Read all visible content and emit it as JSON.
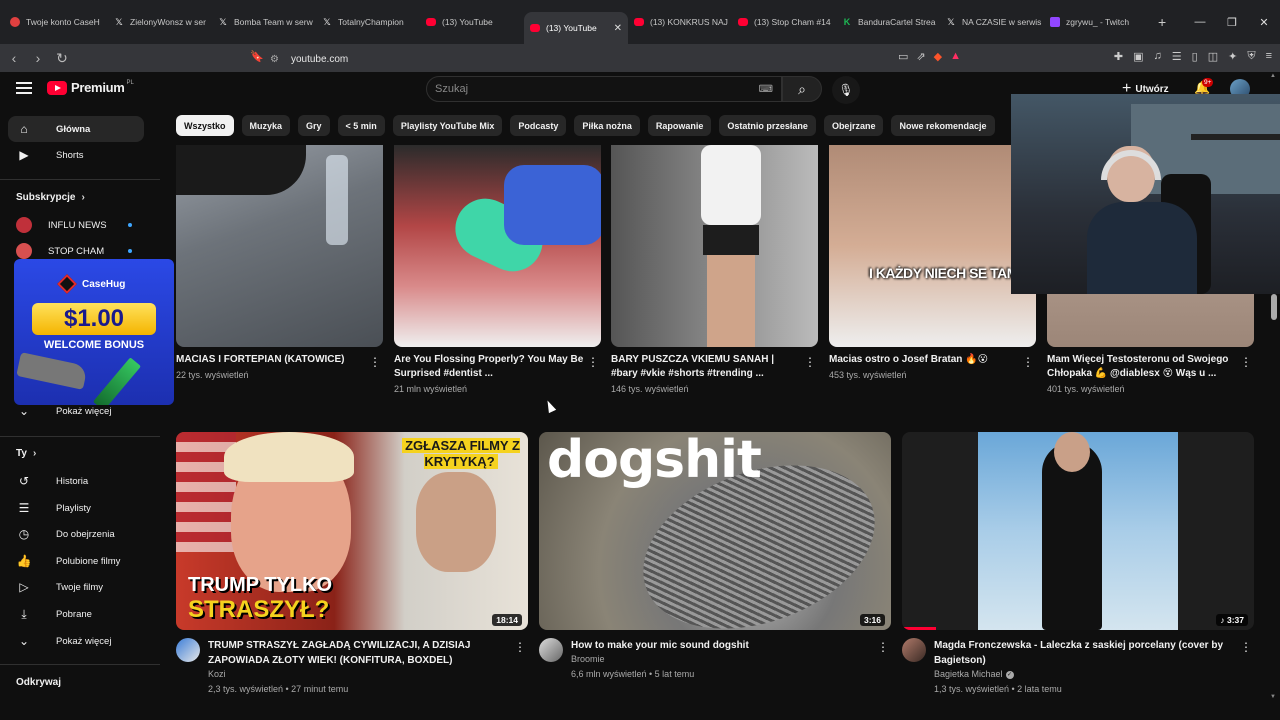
{
  "browser": {
    "tabs": [
      {
        "label": "Twoje konto CaseH",
        "icon": "dot-icon"
      },
      {
        "label": "ZielonyWonsz w ser",
        "icon": "x-icon"
      },
      {
        "label": "Bomba Team w serw",
        "icon": "x-icon"
      },
      {
        "label": "TotalnyChampion",
        "icon": "x-icon"
      },
      {
        "label": "(13) YouTube",
        "icon": "youtube-icon"
      },
      {
        "label": "(13) YouTube",
        "icon": "youtube-icon",
        "active": true
      },
      {
        "label": "(13) KONKRUS NAJ",
        "icon": "youtube-icon"
      },
      {
        "label": "(13) Stop Cham #14",
        "icon": "youtube-icon"
      },
      {
        "label": "BanduraCartel Strea",
        "icon": "kick-icon"
      },
      {
        "label": "NA CZASIE w serwis",
        "icon": "x-icon"
      },
      {
        "label": "zgrywu_ - Twitch",
        "icon": "twitch-icon"
      }
    ],
    "url": "youtube.com"
  },
  "header": {
    "logo_text": "Premium",
    "country": "PL",
    "search_placeholder": "Szukaj",
    "create_label": "Utwórz",
    "notif_count": "9+"
  },
  "sidebar": {
    "main": [
      {
        "label": "Główna",
        "icon": "home-icon"
      },
      {
        "label": "Shorts",
        "icon": "shorts-icon"
      }
    ],
    "subs_heading": "Subskrypcje",
    "subs": [
      {
        "label": "INFLU NEWS"
      },
      {
        "label": "STOP CHAM"
      }
    ],
    "subs_more": "Pokaż więcej",
    "you_heading": "Ty",
    "you": [
      {
        "label": "Historia",
        "icon": "history-icon"
      },
      {
        "label": "Playlisty",
        "icon": "playlist-icon"
      },
      {
        "label": "Do obejrzenia",
        "icon": "clock-icon"
      },
      {
        "label": "Polubione filmy",
        "icon": "thumb-up-icon"
      },
      {
        "label": "Twoje filmy",
        "icon": "video-icon"
      },
      {
        "label": "Pobrane",
        "icon": "download-icon"
      },
      {
        "label": "Pokaż więcej",
        "icon": "chevron-down-icon"
      }
    ],
    "explore_heading": "Odkrywaj"
  },
  "ad": {
    "brand": "CaseHug",
    "price": "$1.00",
    "bonus": "WELCOME BONUS"
  },
  "chips": [
    "Wszystko",
    "Muzyka",
    "Gry",
    "< 5 min",
    "Playlisty YouTube Mix",
    "Podcasty",
    "Piłka nożna",
    "Rapowanie",
    "Ostatnio przesłane",
    "Obejrzane",
    "Nowe rekomendacje"
  ],
  "shorts": [
    {
      "title": "MACIAS I FORTEPIAN (KATOWICE)",
      "views": "22 tys. wyświetleń"
    },
    {
      "title": "Are You Flossing Properly? You May Be Surprised #dentist ...",
      "views": "21 mln wyświetleń"
    },
    {
      "title": "BARY PUSZCZA VKIEMU SANAH | #bary #vkie #shorts #trending ...",
      "views": "146 tys. wyświetleń"
    },
    {
      "title": "Macias ostro o Josef Bratan 🔥😮",
      "views": "453 tys. wyświetleń",
      "caption": "I KAŻDY NIECH SE TAM"
    },
    {
      "title": "Mam Więcej Testosteronu od Swojego Chłopaka 💪 @diablesx 😵 Wąs u ...",
      "views": "401 tys. wyświetleń"
    }
  ],
  "videos": [
    {
      "title": "TRUMP STRASZYŁ ZAGŁADĄ CYWILIZACJI, A DZISIAJ ZAPOWIADA ZŁOTY WIEK! (KONFITURA, BOXDEL)",
      "channel": "Kozi",
      "meta": "2,3 tys. wyświetleń • 27 minut temu",
      "duration": "18:14",
      "thumb_top": "ZGŁASZA FILMY Z KRYTYKĄ?",
      "thumb_bottom_1": "TRUMP TYLKO",
      "thumb_bottom_2": "STRASZYŁ?"
    },
    {
      "title": "How to make your mic sound dogshit",
      "channel": "Broomie",
      "meta": "6,6 mln wyświetleń • 5 lat temu",
      "duration": "3:16",
      "thumb_text": "dogshit"
    },
    {
      "title": "Magda Fronczewska - Laleczka z saskiej porcelany (cover by Bagietson)",
      "channel": "Bagietka Michael",
      "meta": "1,3 tys. wyświetleń • 2 lata temu",
      "duration": "♪ 3:37"
    }
  ]
}
